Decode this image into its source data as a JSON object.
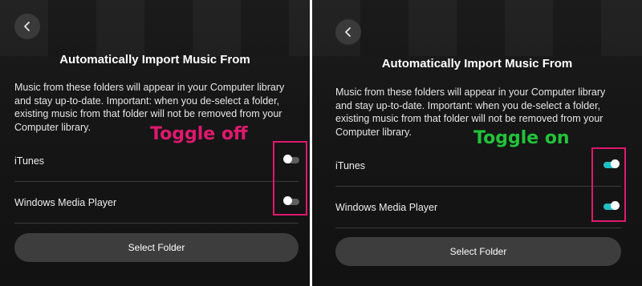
{
  "left_panel": {
    "title": "Automatically Import Music From",
    "description": "Music from these folders will appear in your Computer library and stay up-to-date. Important: when you de-select a folder, existing music from that folder will not be removed from your Computer library.",
    "rows": [
      {
        "label": "iTunes",
        "toggle_state": "off"
      },
      {
        "label": "Windows Media Player",
        "toggle_state": "off"
      }
    ],
    "select_button_label": "Select Folder",
    "annotation": {
      "text": "Toggle off",
      "color": "#e0186e"
    }
  },
  "right_panel": {
    "title": "Automatically Import Music From",
    "description": "Music from these folders will appear in your Computer library and stay up-to-date. Important: when you de-select a folder, existing music from that folder will not be removed from your Computer library.",
    "rows": [
      {
        "label": "iTunes",
        "toggle_state": "on"
      },
      {
        "label": "Windows Media Player",
        "toggle_state": "on"
      }
    ],
    "select_button_label": "Select Folder",
    "annotation": {
      "text": "Toggle on",
      "color": "#22c33a"
    }
  },
  "colors": {
    "panel_bg": "#161616",
    "toggle_on": "#20c0c6",
    "toggle_off": "#5e5e5e",
    "highlight_box": "#e0186e"
  },
  "icons": {
    "back": "chevron-left-icon"
  }
}
